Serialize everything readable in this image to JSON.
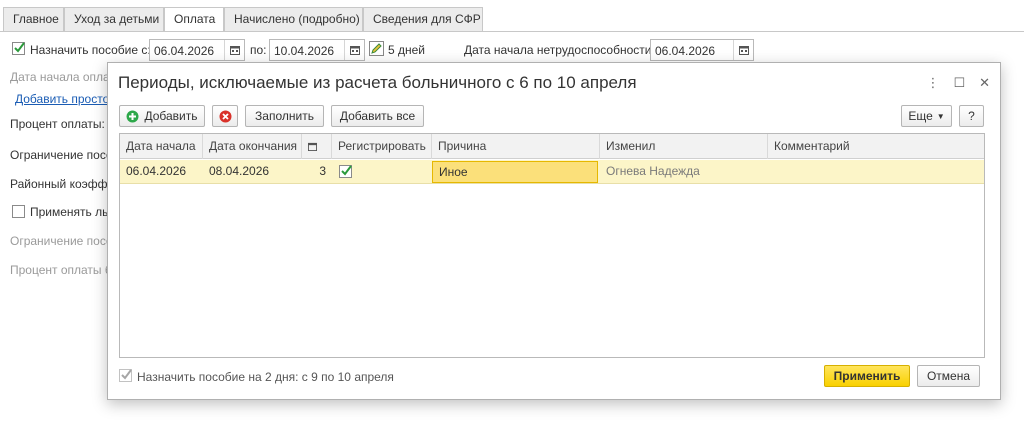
{
  "tabs": [
    {
      "label": "Главное"
    },
    {
      "label": "Уход за детьми"
    },
    {
      "label": "Оплата"
    },
    {
      "label": "Начислено (подробно)"
    },
    {
      "label": "Сведения для СФР"
    }
  ],
  "form": {
    "assign_label": "Назначить пособие с:",
    "date_from": "06.04.2026",
    "to_label": "по:",
    "date_to": "10.04.2026",
    "days_label": "5 дней",
    "disability_start_label": "Дата начала нетрудоспособности:",
    "disability_start_date": "06.04.2026",
    "payment_start_label": "Дата начала оплат",
    "add_simple_link": "Добавить простои",
    "percent_label": "Процент оплаты:",
    "limit_label": "Ограничение посо",
    "district_label": "Районный коэффи",
    "apply_benefits_label": "Применять лы",
    "limit2_label": "Ограничение посо",
    "percent2_label": "Процент оплаты б"
  },
  "dialog": {
    "title": "Периоды, исключаемые из расчета больничного с 6 по 10 апреля",
    "add_button": "Добавить",
    "fill_button": "Заполнить",
    "add_all_button": "Добавить все",
    "more_button": "Еще",
    "help_button": "?",
    "columns": [
      "Дата начала",
      "Дата окончания",
      "",
      "Регистрировать",
      "Причина",
      "Изменил",
      "Комментарий"
    ],
    "rows": [
      {
        "start": "06.04.2026",
        "end": "08.04.2026",
        "days": "3",
        "register": true,
        "reason": "Иное",
        "changed_by": "Огнева Надежда",
        "comment": ""
      }
    ],
    "footer_text": "Назначить пособие на 2 дня: с 9 по 10 апреля",
    "apply_button": "Применить",
    "cancel_button": "Отмена"
  }
}
